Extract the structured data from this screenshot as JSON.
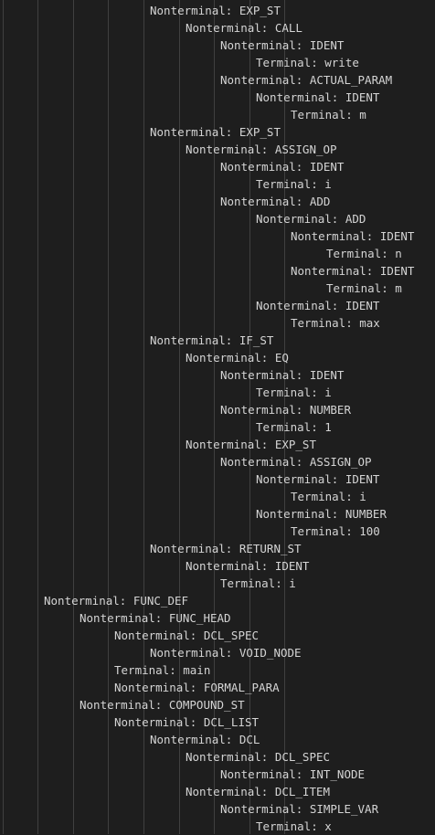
{
  "tree_lines": [
    {
      "depth": 4,
      "kind": "Nonterminal",
      "label": "EXP_ST"
    },
    {
      "depth": 5,
      "kind": "Nonterminal",
      "label": "CALL"
    },
    {
      "depth": 6,
      "kind": "Nonterminal",
      "label": "IDENT"
    },
    {
      "depth": 7,
      "kind": "Terminal",
      "label": "write"
    },
    {
      "depth": 6,
      "kind": "Nonterminal",
      "label": "ACTUAL_PARAM"
    },
    {
      "depth": 7,
      "kind": "Nonterminal",
      "label": "IDENT"
    },
    {
      "depth": 8,
      "kind": "Terminal",
      "label": "m"
    },
    {
      "depth": 4,
      "kind": "Nonterminal",
      "label": "EXP_ST"
    },
    {
      "depth": 5,
      "kind": "Nonterminal",
      "label": "ASSIGN_OP"
    },
    {
      "depth": 6,
      "kind": "Nonterminal",
      "label": "IDENT"
    },
    {
      "depth": 7,
      "kind": "Terminal",
      "label": "i"
    },
    {
      "depth": 6,
      "kind": "Nonterminal",
      "label": "ADD"
    },
    {
      "depth": 7,
      "kind": "Nonterminal",
      "label": "ADD"
    },
    {
      "depth": 8,
      "kind": "Nonterminal",
      "label": "IDENT"
    },
    {
      "depth": 9,
      "kind": "Terminal",
      "label": "n"
    },
    {
      "depth": 8,
      "kind": "Nonterminal",
      "label": "IDENT"
    },
    {
      "depth": 9,
      "kind": "Terminal",
      "label": "m"
    },
    {
      "depth": 7,
      "kind": "Nonterminal",
      "label": "IDENT"
    },
    {
      "depth": 8,
      "kind": "Terminal",
      "label": "max"
    },
    {
      "depth": 4,
      "kind": "Nonterminal",
      "label": "IF_ST"
    },
    {
      "depth": 5,
      "kind": "Nonterminal",
      "label": "EQ"
    },
    {
      "depth": 6,
      "kind": "Nonterminal",
      "label": "IDENT"
    },
    {
      "depth": 7,
      "kind": "Terminal",
      "label": "i"
    },
    {
      "depth": 6,
      "kind": "Nonterminal",
      "label": "NUMBER"
    },
    {
      "depth": 7,
      "kind": "Terminal",
      "label": "1"
    },
    {
      "depth": 5,
      "kind": "Nonterminal",
      "label": "EXP_ST"
    },
    {
      "depth": 6,
      "kind": "Nonterminal",
      "label": "ASSIGN_OP"
    },
    {
      "depth": 7,
      "kind": "Nonterminal",
      "label": "IDENT"
    },
    {
      "depth": 8,
      "kind": "Terminal",
      "label": "i"
    },
    {
      "depth": 7,
      "kind": "Nonterminal",
      "label": "NUMBER"
    },
    {
      "depth": 8,
      "kind": "Terminal",
      "label": "100"
    },
    {
      "depth": 4,
      "kind": "Nonterminal",
      "label": "RETURN_ST"
    },
    {
      "depth": 5,
      "kind": "Nonterminal",
      "label": "IDENT"
    },
    {
      "depth": 6,
      "kind": "Terminal",
      "label": "i"
    },
    {
      "depth": 1,
      "kind": "Nonterminal",
      "label": "FUNC_DEF"
    },
    {
      "depth": 2,
      "kind": "Nonterminal",
      "label": "FUNC_HEAD"
    },
    {
      "depth": 3,
      "kind": "Nonterminal",
      "label": "DCL_SPEC"
    },
    {
      "depth": 4,
      "kind": "Nonterminal",
      "label": "VOID_NODE"
    },
    {
      "depth": 3,
      "kind": "Terminal",
      "label": "main"
    },
    {
      "depth": 3,
      "kind": "Nonterminal",
      "label": "FORMAL_PARA"
    },
    {
      "depth": 2,
      "kind": "Nonterminal",
      "label": "COMPOUND_ST"
    },
    {
      "depth": 3,
      "kind": "Nonterminal",
      "label": "DCL_LIST"
    },
    {
      "depth": 4,
      "kind": "Nonterminal",
      "label": "DCL"
    },
    {
      "depth": 5,
      "kind": "Nonterminal",
      "label": "DCL_SPEC"
    },
    {
      "depth": 6,
      "kind": "Nonterminal",
      "label": "INT_NODE"
    },
    {
      "depth": 5,
      "kind": "Nonterminal",
      "label": "DCL_ITEM"
    },
    {
      "depth": 6,
      "kind": "Nonterminal",
      "label": "SIMPLE_VAR"
    },
    {
      "depth": 7,
      "kind": "Terminal",
      "label": "x"
    }
  ],
  "colors": {
    "background": "#1e1e1e",
    "text": "#d4d4d4",
    "guide": "#404040"
  }
}
